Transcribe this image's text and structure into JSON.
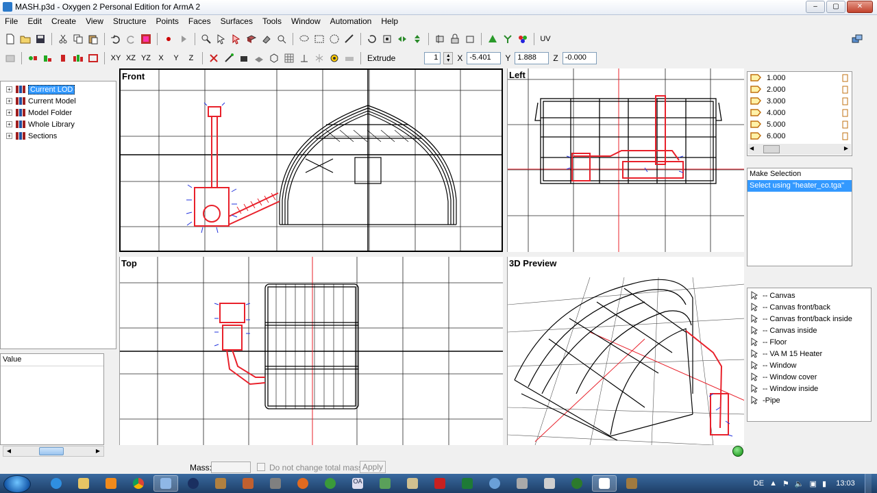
{
  "window": {
    "title": "MASH.p3d - Oxygen 2 Personal Edition for ArmA 2",
    "buttons": [
      "–",
      "▢",
      "✕"
    ]
  },
  "menu": [
    "File",
    "Edit",
    "Create",
    "View",
    "Structure",
    "Points",
    "Faces",
    "Surfaces",
    "Tools",
    "Window",
    "Automation",
    "Help"
  ],
  "toolbar2": {
    "axes": [
      "XY",
      "XZ",
      "YZ",
      "X",
      "Y",
      "Z"
    ],
    "extrude_label": "Extrude",
    "extrude_value": "1",
    "x_label": "X",
    "x_value": "-5.401",
    "y_label": "Y",
    "y_value": "1.888",
    "z_label": "Z",
    "z_value": "-0.000",
    "uv_label": "UV"
  },
  "tree": {
    "items": [
      {
        "label": "Current LOD",
        "selected": true
      },
      {
        "label": "Current Model"
      },
      {
        "label": "Model Folder"
      },
      {
        "label": "Whole Library"
      },
      {
        "label": "Sections"
      }
    ]
  },
  "value_panel": {
    "header": "Value"
  },
  "viewports": {
    "front": "Front",
    "left": "Left",
    "top": "Top",
    "preview": "3D Preview"
  },
  "lods": [
    "1.000",
    "2.000",
    "3.000",
    "4.000",
    "5.000",
    "6.000"
  ],
  "selection": {
    "items": [
      "Make Selection",
      "Select using \"heater_co.tga\""
    ]
  },
  "named_selections": [
    "-- Canvas",
    "-- Canvas front/back",
    "-- Canvas front/back inside",
    "-- Canvas inside",
    "-- Floor",
    "-- VA M 15 Heater",
    "-- Window",
    "-- Window cover",
    "-- Window inside",
    "-Pipe"
  ],
  "mass_bar": {
    "label": "Mass:",
    "checkbox_label": "Do not change total mass",
    "apply_label": "Apply"
  },
  "taskbar": {
    "language": "DE",
    "time": "13:03"
  },
  "colors": {
    "selection_red": "#e8202a",
    "wire_black": "#000000",
    "normal_blue": "#2233dd",
    "accent_blue": "#3399ff"
  }
}
